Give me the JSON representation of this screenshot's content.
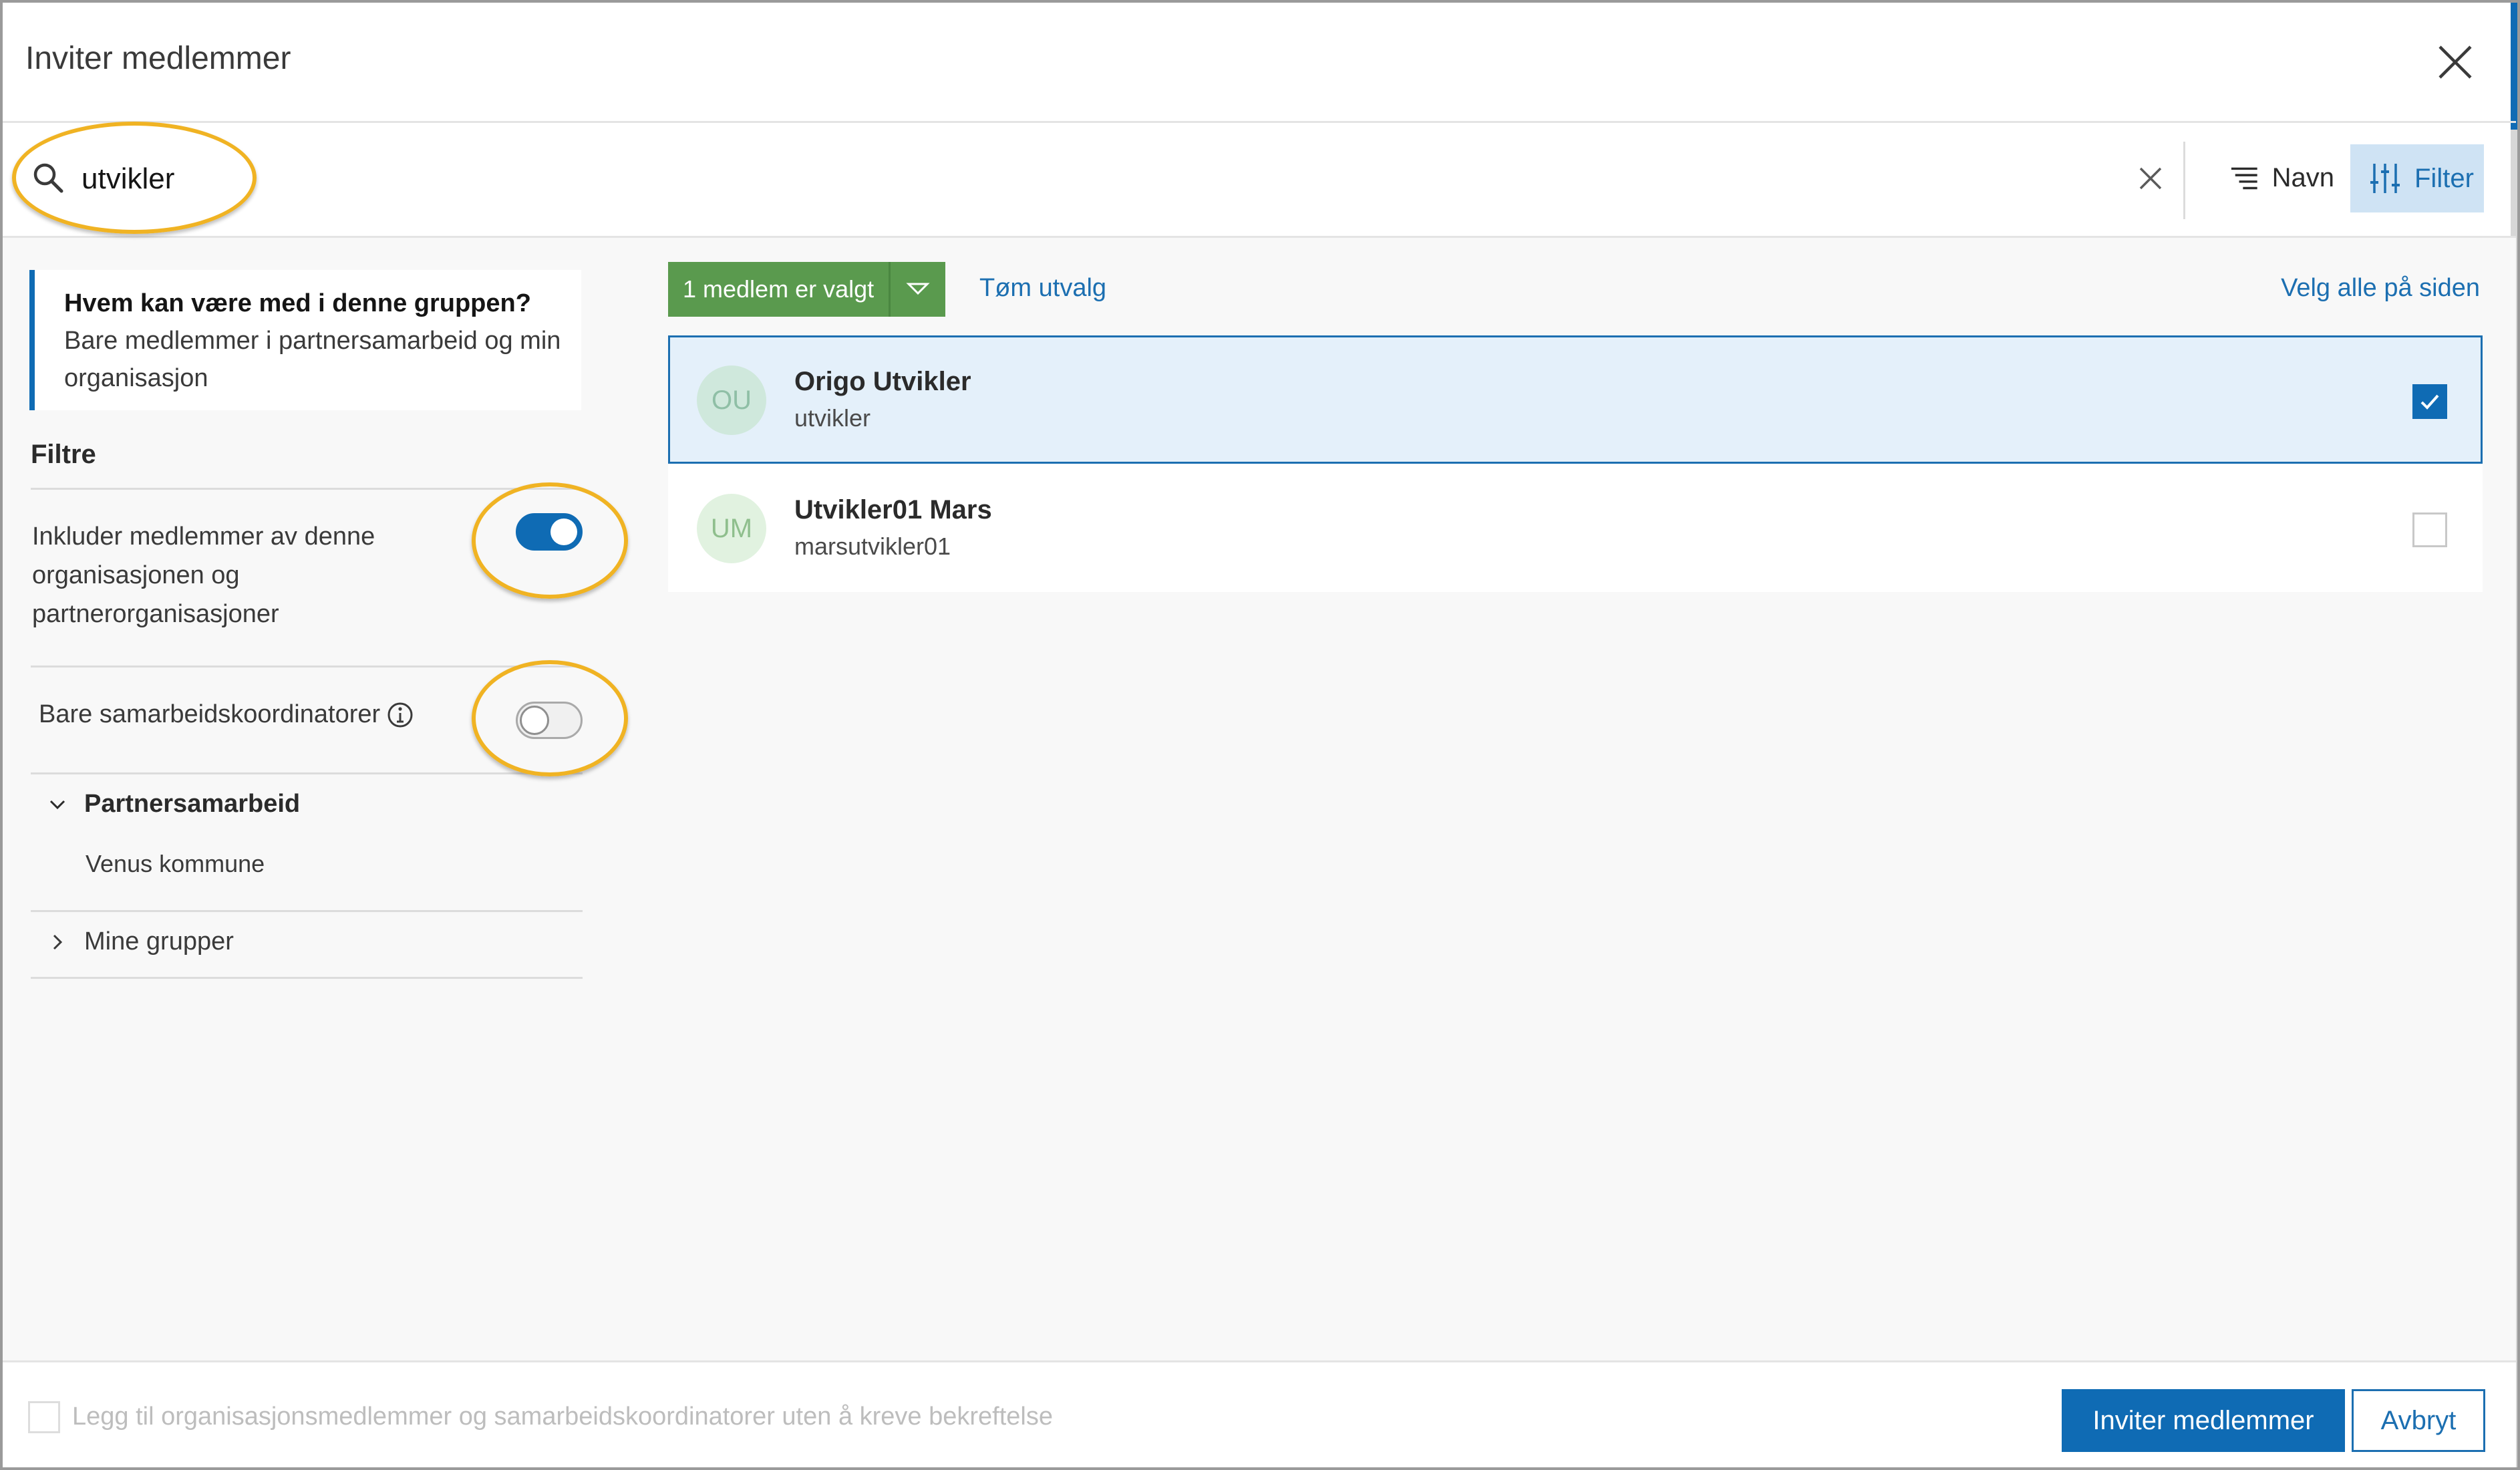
{
  "dialog": {
    "title": "Inviter medlemmer",
    "close_icon": "close-icon"
  },
  "search": {
    "value": "utvikler",
    "placeholder": "",
    "sort_label": "Navn",
    "filter_label": "Filter"
  },
  "info": {
    "title": "Hvem kan være med i denne gruppen?",
    "text": "Bare medlemmer i partnersamarbeid og min organisasjon"
  },
  "filters": {
    "heading": "Filtre",
    "include_toggle": {
      "label": "Inkluder medlemmer av denne organisasjonen og partnerorganisasjoner",
      "checked": true
    },
    "coordinators_toggle": {
      "label": "Bare samarbeidskoordinatorer",
      "checked": false
    },
    "tree": [
      {
        "label": "Partnersamarbeid",
        "expanded": true,
        "children": [
          "Venus kommune"
        ]
      },
      {
        "label": "Mine grupper",
        "expanded": false,
        "children": []
      }
    ]
  },
  "selection": {
    "selected_label": "1 medlem er valgt",
    "clear_label": "Tøm utvalg",
    "select_all_label": "Velg alle på siden"
  },
  "members": [
    {
      "initials": "OU",
      "name": "Origo Utvikler",
      "username": "utvikler",
      "selected": true
    },
    {
      "initials": "UM",
      "name": "Utvikler01 Mars",
      "username": "marsutvikler01",
      "selected": false
    }
  ],
  "footer": {
    "checkbox_label": "Legg til organisasjonsmedlemmer og samarbeidskoordinatorer uten å kreve bekreftelse",
    "invite_label": "Inviter medlemmer",
    "cancel_label": "Avbryt"
  },
  "colors": {
    "accent": "#0f6bb4",
    "selected_badge": "#5a9a4e",
    "highlight_ring": "#f0b323"
  }
}
